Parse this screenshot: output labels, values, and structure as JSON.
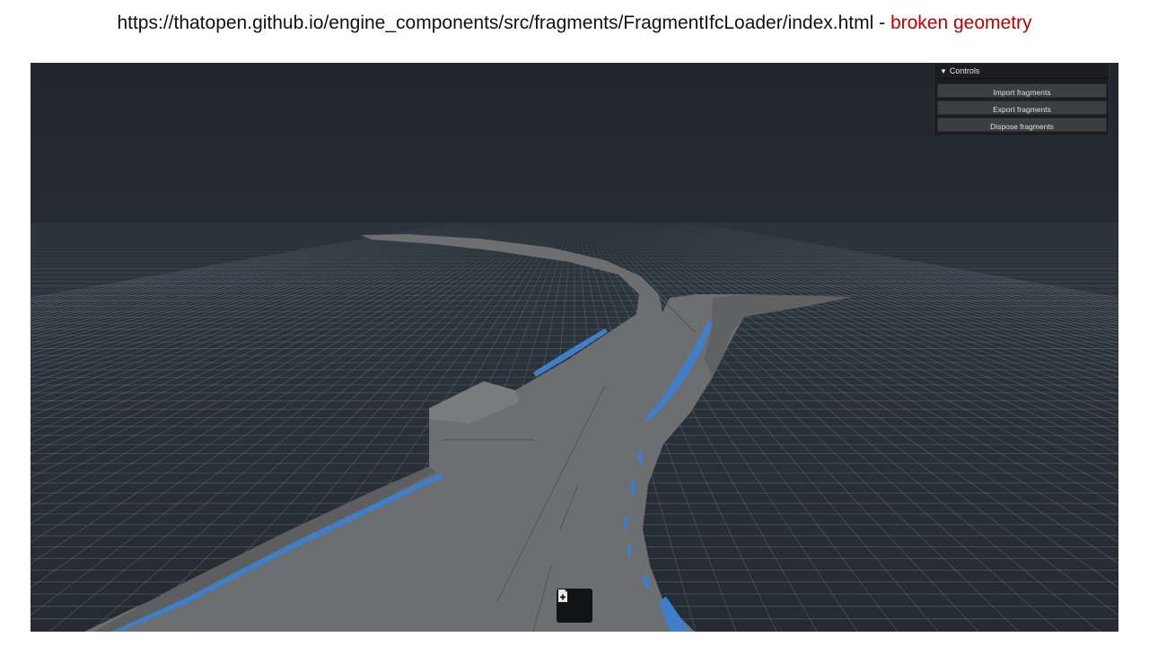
{
  "caption": {
    "url": "https://thatopen.github.io/engine_components/src/fragments/FragmentIfcLoader/index.html",
    "separator": " - ",
    "note": "broken geometry",
    "note_color": "#c00000"
  },
  "controls": {
    "title": "Controls",
    "buttons": [
      {
        "label": "Import fragments"
      },
      {
        "label": "Export fragments"
      },
      {
        "label": "Dispose fragments"
      }
    ]
  },
  "colors": {
    "sky": "#232a31",
    "grid": "#8a96a3",
    "road": "#6e6f70",
    "accent": "#3f7fc9"
  },
  "icons": {
    "collapse": "chevron-down-icon",
    "main_action": "file-plus-icon"
  }
}
